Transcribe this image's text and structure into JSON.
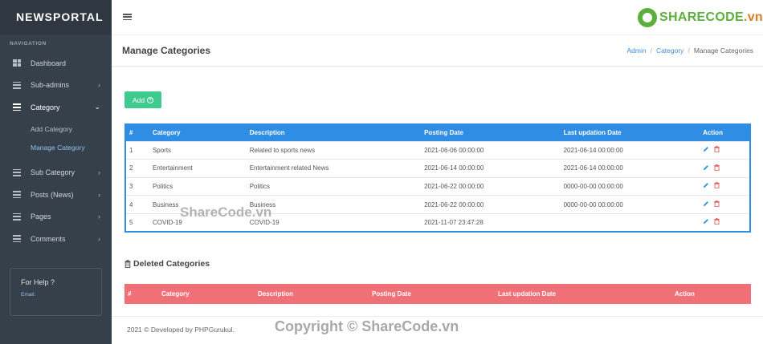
{
  "brand": "NEWSPORTAL",
  "sidebar": {
    "nav_title": "NAVIGATION",
    "items": [
      {
        "label": "Dashboard"
      },
      {
        "label": "Sub-admins"
      },
      {
        "label": "Category"
      },
      {
        "label": "Sub Category"
      },
      {
        "label": "Posts (News)"
      },
      {
        "label": "Pages"
      },
      {
        "label": "Comments"
      }
    ],
    "category_sub": [
      {
        "label": "Add Category"
      },
      {
        "label": "Manage Category"
      }
    ],
    "help_title": "For Help ?",
    "help_email_label": "Email:"
  },
  "header": {
    "logo_share": "SHARE",
    "logo_code": "CODE",
    "logo_tld": ".vn"
  },
  "page": {
    "title": "Manage Categories",
    "breadcrumb": [
      "Admin",
      "Category",
      "Manage Categories"
    ]
  },
  "add_button": {
    "label": "Add",
    "icon": "plus-circle-icon"
  },
  "categories_table": {
    "columns": [
      "#",
      "Category",
      "Description",
      "Posting Date",
      "Last updation Date",
      "Action"
    ],
    "rows": [
      {
        "num": "1",
        "category": "Sports",
        "description": "Related to sports news",
        "posting": "2021-06-06 00:00:00",
        "updated": "2021-06-14 00:00:00"
      },
      {
        "num": "2",
        "category": "Entertainment",
        "description": "Entertainment related News",
        "posting": "2021-06-14 00:00:00",
        "updated": "2021-06-14 00:00:00"
      },
      {
        "num": "3",
        "category": "Politics",
        "description": "Politics",
        "posting": "2021-06-22 00:00:00",
        "updated": "0000-00-00 00:00:00"
      },
      {
        "num": "4",
        "category": "Business",
        "description": "Business",
        "posting": "2021-06-22 00:00:00",
        "updated": "0000-00-00 00:00:00"
      },
      {
        "num": "5",
        "category": "COVID-19",
        "description": "COVID-19",
        "posting": "2021-11-07 23:47:28",
        "updated": ""
      }
    ]
  },
  "deleted": {
    "title": "Deleted Categories",
    "columns": [
      "#",
      "Category",
      "Description",
      "Posting Date",
      "Last updation Date",
      "Action"
    ]
  },
  "footer": {
    "text": "2021 © Developed by PHPGurukul."
  },
  "watermarks": {
    "center": "ShareCode.vn",
    "bottom": "Copyright © ShareCode.vn"
  },
  "colors": {
    "primary": "#2f8de4",
    "add": "#3fca8f",
    "danger_header": "#f07078",
    "sidebar": "#36404a"
  }
}
